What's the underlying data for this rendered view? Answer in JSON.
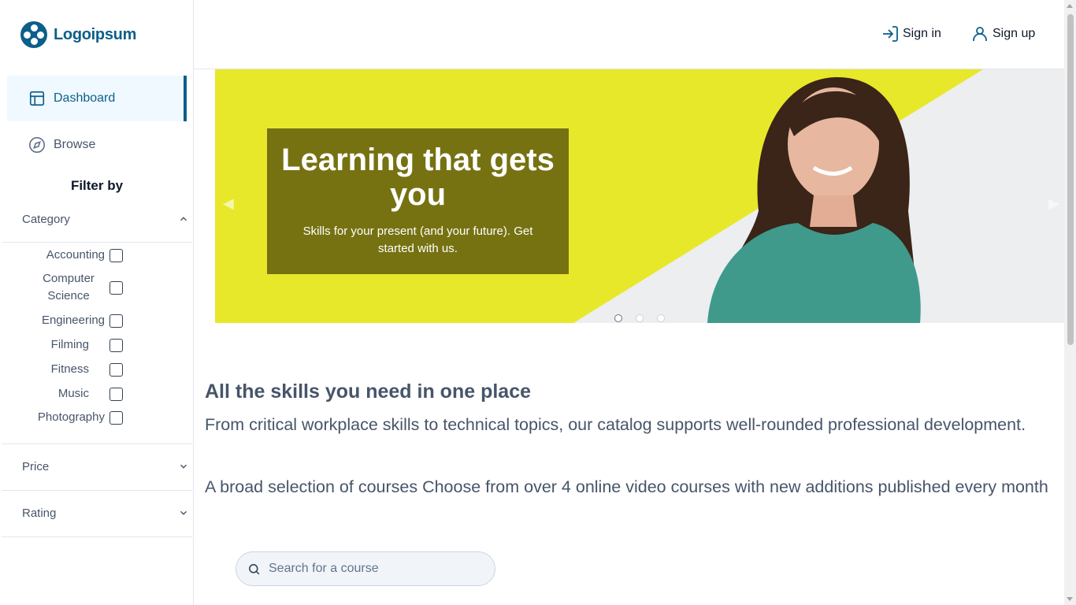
{
  "brand": {
    "name": "Logoipsum",
    "color": "#0c5f8a",
    "icon": "logo-icon"
  },
  "sidebar": {
    "nav": [
      {
        "label": "Dashboard",
        "icon": "layout-icon",
        "active": true
      },
      {
        "label": "Browse",
        "icon": "compass-icon",
        "active": false
      }
    ],
    "filter_title": "Filter by",
    "category": {
      "label": "Category",
      "expanded": true,
      "items": [
        "Accounting",
        "Computer Science",
        "Engineering",
        "Filming",
        "Fitness",
        "Music",
        "Photography"
      ]
    },
    "price": {
      "label": "Price",
      "expanded": false
    },
    "rating": {
      "label": "Rating",
      "expanded": false
    }
  },
  "header": {
    "sign_in": "Sign in",
    "sign_up": "Sign up"
  },
  "banner": {
    "title": "Learning that gets you",
    "subtitle": "Skills for your present (and your future). Get started with us.",
    "slide_count": 3,
    "active_slide": 1,
    "colors": {
      "yellow": "#e8e82a",
      "box": "#767212"
    }
  },
  "content": {
    "heading": "All the skills you need in one place",
    "paragraph_1": "From critical workplace skills to technical topics, our catalog supports well-rounded professional development.",
    "paragraph_2": "A broad selection of courses Choose from over 4 online video courses with new additions published every month"
  },
  "search": {
    "placeholder": "Search for a course",
    "value": ""
  }
}
